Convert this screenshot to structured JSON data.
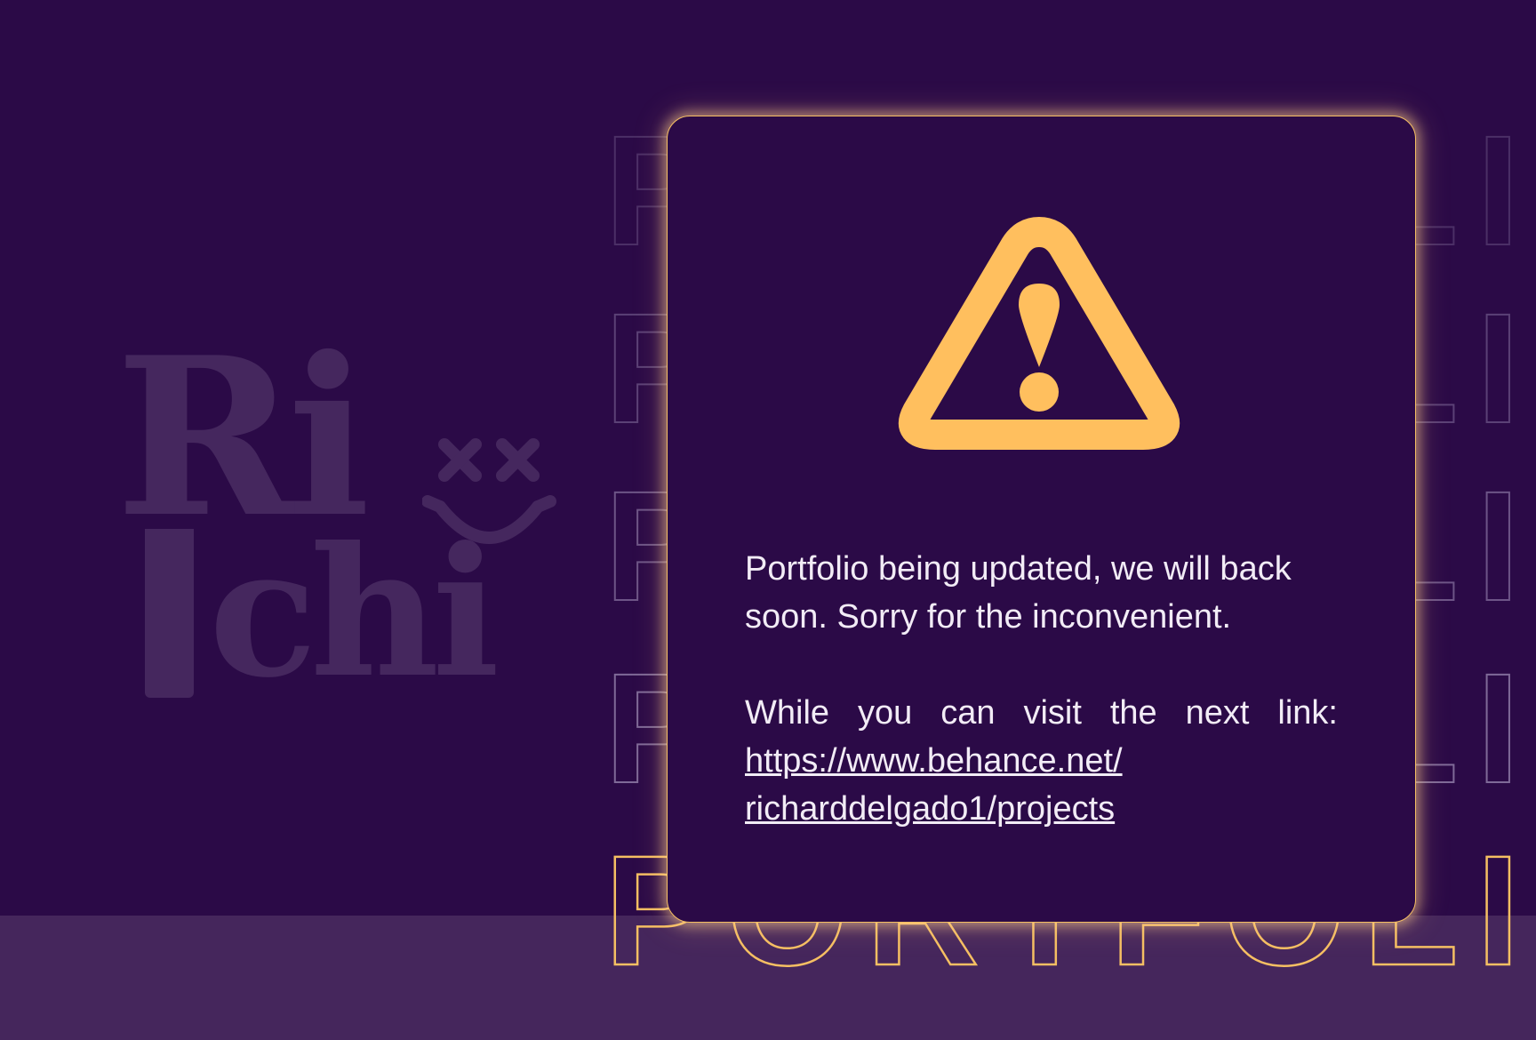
{
  "background": {
    "color": "#2b0a47",
    "band_color": "#45265c"
  },
  "logo": {
    "top_text": "Ri",
    "bottom_text": "chi",
    "color": "#45275e",
    "smiley_icon": "dead-smiley-icon"
  },
  "background_text": {
    "word": "PORTFOLIO",
    "accent_color": "#f5bf63"
  },
  "modal": {
    "icon": "warning-triangle-icon",
    "icon_color": "#ffbf5e",
    "message": "Portfolio being updated, we will back soon. Sorry for the inconvenient.",
    "link_intro": "While you can visit the next link:",
    "link_text": "https://www.behance.net/ richarddelgado1/projects",
    "link_href": "https://www.behance.net/richarddelgado1/projects"
  }
}
